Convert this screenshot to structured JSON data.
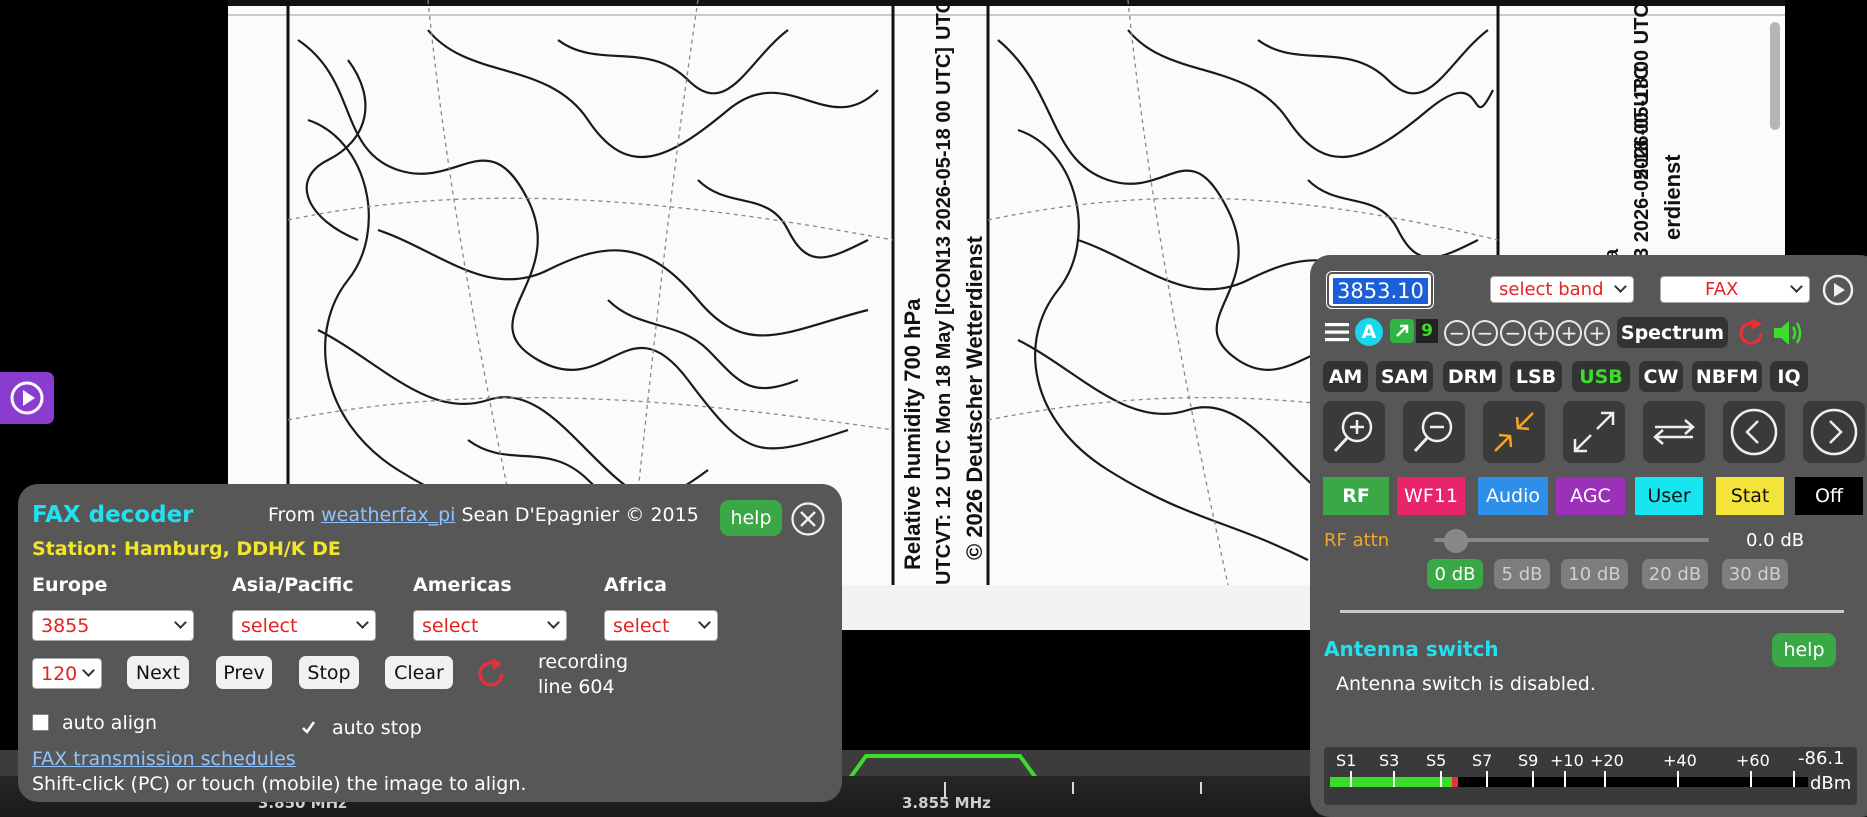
{
  "fax_image": {
    "left_caption": [
      "Relative humidity 700 hPa",
      "UTCVT: 12 UTC Mon  18 May [ICON13 2026-05-18 00 UTC]",
      "© 2026 Deutscher Wetterdienst"
    ],
    "right_caption": [
      "a",
      "ON13 2026-05-18 00 UTC",
      "erdienst"
    ],
    "top_right_fragment": "2026-05-18 00 UTC",
    "top_mid_fragment": "UTC"
  },
  "scale": {
    "label_left": "3.850 MHz",
    "label_right": "3.855 MHz"
  },
  "fax_decoder": {
    "title": "FAX decoder",
    "from_prefix": "From",
    "from_link": "weatherfax_pi",
    "author": "Sean D'Epagnier © 2015",
    "help": "help",
    "station": "Station: Hamburg, DDH/K DE",
    "regions": [
      {
        "label": "Europe",
        "value": "3855"
      },
      {
        "label": "Asia/Pacific",
        "value": "select"
      },
      {
        "label": "Americas",
        "value": "select"
      },
      {
        "label": "Africa",
        "value": "select"
      }
    ],
    "lpm_value": "120",
    "buttons": {
      "next": "Next",
      "prev": "Prev",
      "stop": "Stop",
      "clear": "Clear"
    },
    "status_line1": "recording",
    "status_line2": "line 604",
    "auto_align": {
      "label": "auto align",
      "checked": false
    },
    "auto_stop": {
      "label": "auto stop",
      "checked": true
    },
    "schedules_link": "FAX transmission schedules",
    "hint": "Shift-click (PC) or touch (mobile) the image to align."
  },
  "control": {
    "frequency": "3853.10",
    "band_select": "select band",
    "mode_select": "FAX",
    "spectrum_label": "Spectrum",
    "badge_a": "A",
    "badge_9": "9",
    "modes": [
      "AM",
      "SAM",
      "DRM",
      "LSB",
      "USB",
      "CW",
      "NBFM",
      "IQ"
    ],
    "active_mode": "USB",
    "tabs": [
      "RF",
      "WF11",
      "Audio",
      "AGC",
      "User",
      "Stat",
      "Off"
    ],
    "tab_colors": {
      "RF": "#3aa846",
      "WF11": "#e8246a",
      "Audio": "#2e8fe8",
      "AGC": "#9b31b8",
      "User": "#17e6f0",
      "Stat": "#f4e33a",
      "Off": "#000000"
    },
    "rf_attn_label": "RF attn",
    "rf_attn_value": "0.0 dB",
    "rf_attn_level": 0,
    "db_options": [
      "0 dB",
      "5 dB",
      "10 dB",
      "20 dB",
      "30 dB"
    ],
    "db_selected": "0 dB",
    "antenna_title": "Antenna switch",
    "antenna_help": "help",
    "antenna_status": "Antenna switch is disabled.",
    "smeter_labels": [
      "S1",
      "S3",
      "S5",
      "S7",
      "S9",
      "+10",
      "+20",
      "+40",
      "+60"
    ],
    "smeter_value": "-86.1",
    "smeter_unit": "dBm",
    "smeter_level_dbm": -86.1
  }
}
